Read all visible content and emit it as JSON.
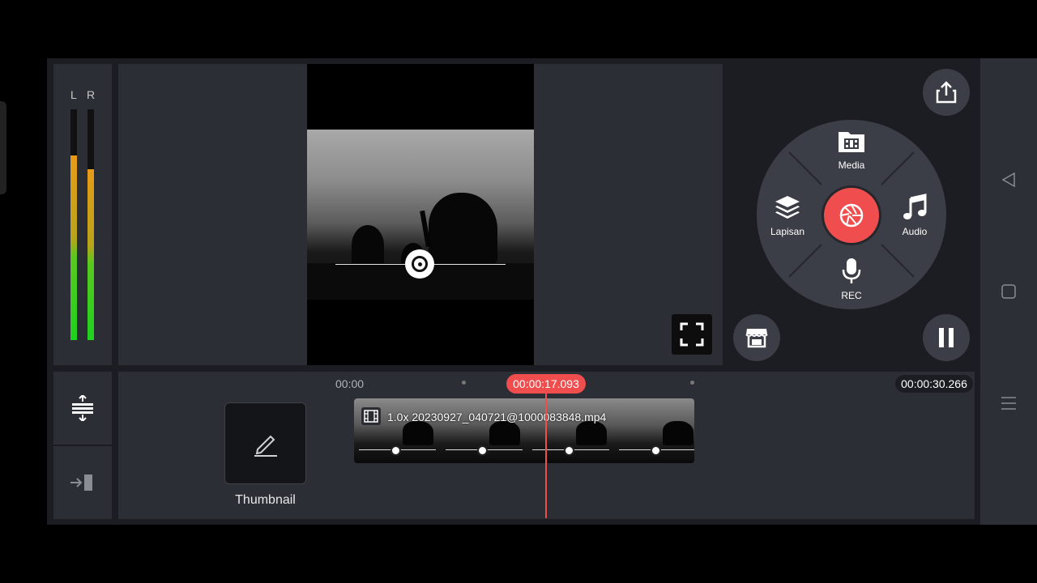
{
  "meter": {
    "left_label": "L",
    "right_label": "R",
    "left_level": 0.8,
    "right_level": 0.74
  },
  "wheel": {
    "media_label": "Media",
    "layer_label": "Lapisan",
    "audio_label": "Audio",
    "rec_label": "REC",
    "accent": "#f04e4e"
  },
  "timeline": {
    "start_time": "00:00",
    "playhead_time": "00:00:17.093",
    "end_time": "00:00:30.266",
    "clip_name": "1.0x 20230927_040721@1000083848.mp4",
    "thumbnail_label": "Thumbnail"
  },
  "icons": {
    "share": "share-icon",
    "fullscreen": "fullscreen-icon",
    "store": "store-icon",
    "pause": "pause-icon",
    "capture": "camera-shutter-icon"
  }
}
